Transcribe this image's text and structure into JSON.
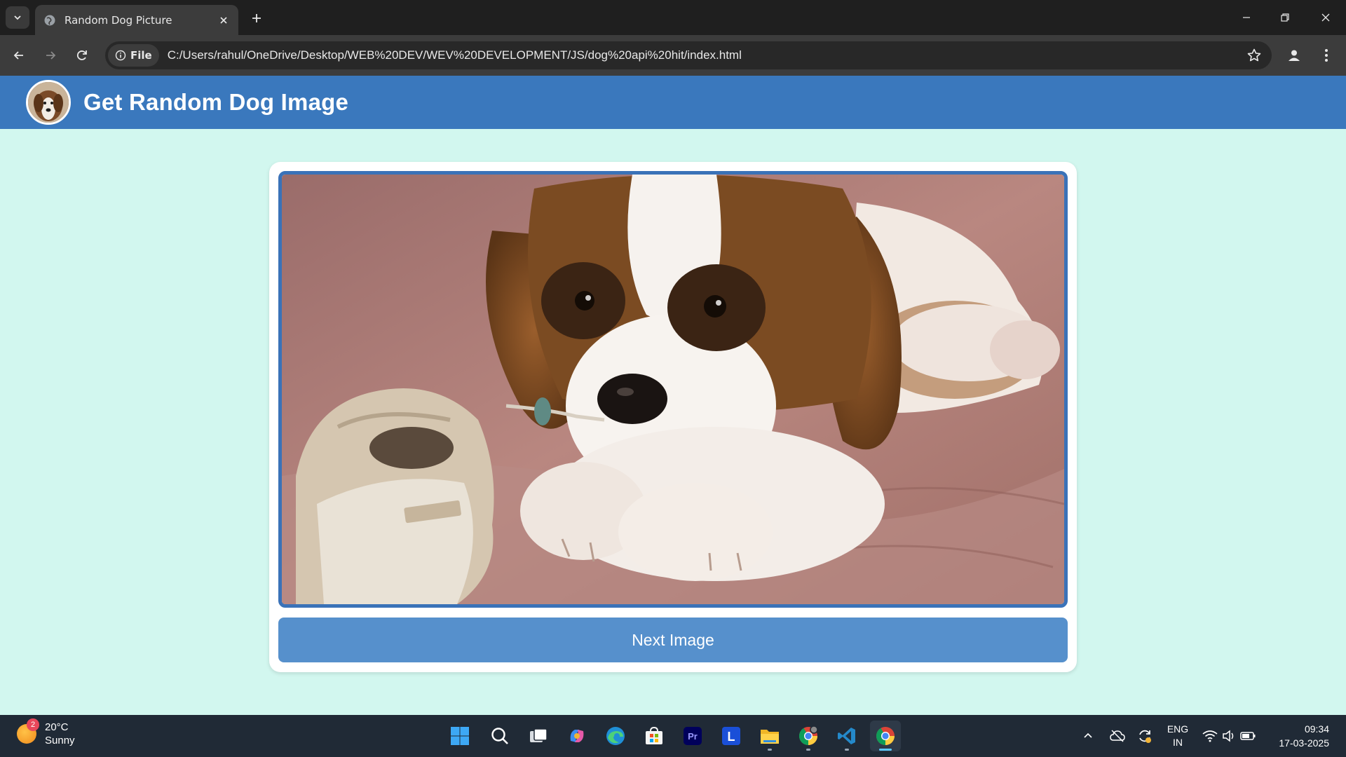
{
  "browser": {
    "tab_title": "Random Dog Picture",
    "site_chip": "File",
    "url": "C:/Users/rahul/OneDrive/Desktop/WEB%20DEV/WEV%20DEVELOPMENT/JS/dog%20api%20hit/index.html"
  },
  "app": {
    "title": "Get Random Dog Image",
    "next_button": "Next Image",
    "image_alt": "Saint Bernard puppy lying next to a sneaker"
  },
  "taskbar": {
    "weather_temp": "20°C",
    "weather_desc": "Sunny",
    "weather_badge": "2",
    "lang_primary": "ENG",
    "lang_secondary": "IN",
    "time": "09:34",
    "date": "17-03-2025",
    "apps": [
      "start-icon",
      "search-icon",
      "task-view-icon",
      "copilot-icon",
      "edge-icon",
      "store-icon",
      "premiere-icon",
      "l-app-icon",
      "file-explorer-icon",
      "chrome-icon",
      "vscode-icon",
      "chrome-active-icon"
    ]
  },
  "colors": {
    "navbar": "#3a78bd",
    "page_bg": "#d2f7ef",
    "button": "#5690cc",
    "image_border": "#3a72b8"
  }
}
